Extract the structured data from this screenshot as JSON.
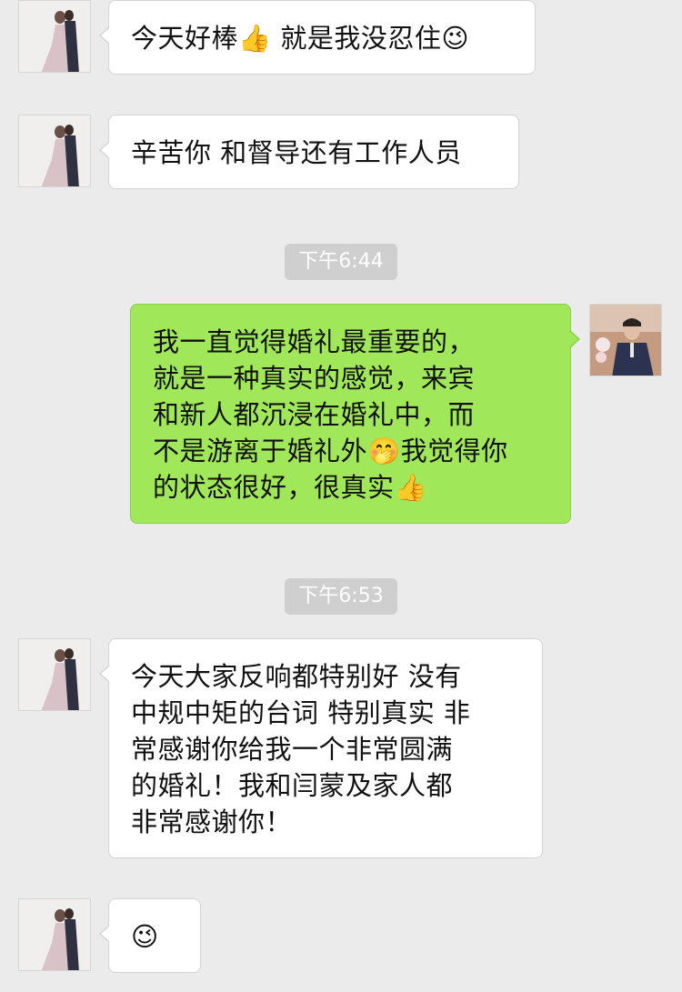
{
  "messages": [
    {
      "side": "left",
      "sender": "bride-groom",
      "text": "今天好棒👍 就是我没忍住😉"
    },
    {
      "side": "left",
      "sender": "bride-groom",
      "text": "辛苦你 和督导还有工作人员"
    },
    {
      "type": "time",
      "text": "下午6:44"
    },
    {
      "side": "right",
      "sender": "host",
      "text": "我一直觉得婚礼最重要的，\n就是一种真实的感觉，来宾\n和新人都沉浸在婚礼中，而\n不是游离于婚礼外🤭我觉得你\n的状态很好，很真实👍"
    },
    {
      "type": "time",
      "text": "下午6:53"
    },
    {
      "side": "left",
      "sender": "bride-groom",
      "text": "今天大家反响都特别好 没有\n中规中矩的台词 特别真实 非\n常感谢你给我一个非常圆满\n的婚礼！我和闫蒙及家人都\n非常感谢你！"
    },
    {
      "side": "left",
      "sender": "bride-groom",
      "text": "😉"
    }
  ],
  "colors": {
    "background": "#ebebeb",
    "bubble_left": "#ffffff",
    "bubble_right": "#a0e75a",
    "timestamp_bg": "#cfcfcf",
    "timestamp_text": "#ffffff"
  }
}
